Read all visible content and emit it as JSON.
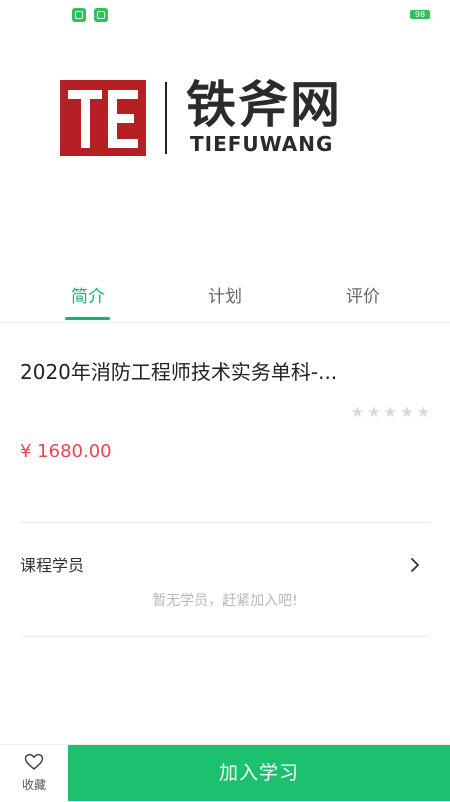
{
  "status_bar": {
    "battery": "98"
  },
  "logo": {
    "name_cn": "铁斧网",
    "name_en": "TIEFUWANG"
  },
  "tabs": [
    {
      "label": "简介"
    },
    {
      "label": "计划"
    },
    {
      "label": "评价"
    }
  ],
  "course": {
    "title": "2020年消防工程师技术实务单科-...",
    "rating_stars": 0,
    "rating_max": 5,
    "price": "¥ 1680.00"
  },
  "students": {
    "title": "课程学员",
    "empty_message": "暂无学员，赶紧加入吧!"
  },
  "bottom_bar": {
    "favorite_label": "收藏",
    "join_label": "加入学习"
  },
  "colors": {
    "accent": "#19b36e",
    "button": "#1bc16e",
    "price": "#e8474f",
    "logo_red": "#b52025"
  }
}
